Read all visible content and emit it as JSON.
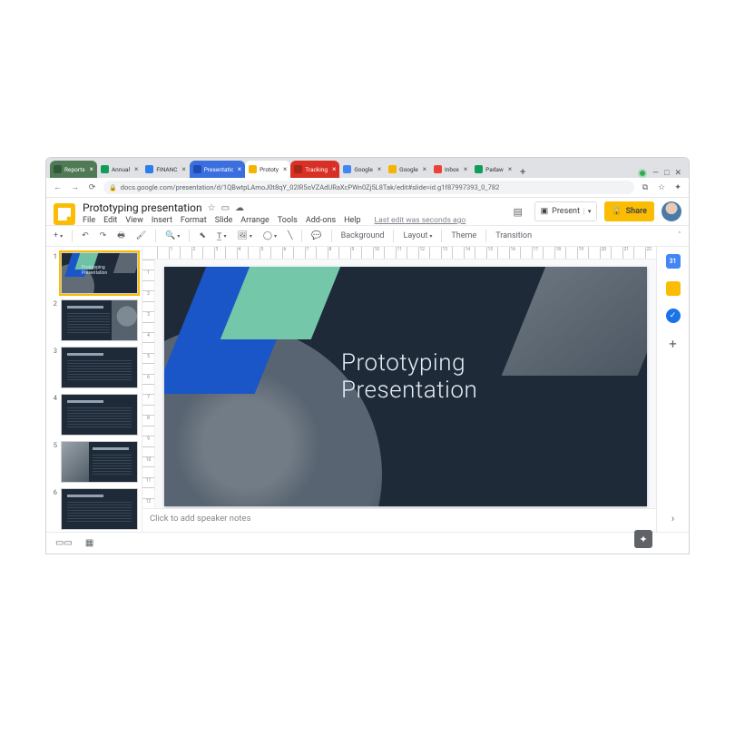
{
  "browser": {
    "tabs": [
      {
        "label": "Reports",
        "color": "#4f7a55",
        "text": "#fff",
        "fav": "#2f5a38"
      },
      {
        "label": "Annual",
        "color": "",
        "text": "",
        "fav": "#0f9d58"
      },
      {
        "label": "FINANC",
        "color": "",
        "text": "",
        "fav": "#2b7de9"
      },
      {
        "label": "Presentations",
        "color": "#3b6fe0",
        "text": "#fff",
        "fav": "#1c4db3"
      },
      {
        "label": "Prototy",
        "color": "#fff",
        "text": "#333",
        "fav": "#f4b400",
        "active": true
      },
      {
        "label": "Tracking",
        "color": "#d93025",
        "text": "#fff",
        "fav": "#a52714"
      },
      {
        "label": "Google",
        "color": "",
        "text": "",
        "fav": "#4285f4"
      },
      {
        "label": "Google",
        "color": "",
        "text": "",
        "fav": "#f4b400"
      },
      {
        "label": "Inbox",
        "color": "",
        "text": "",
        "fav": "#ea4335"
      },
      {
        "label": "Padaw",
        "color": "",
        "text": "",
        "fav": "#0f9d58"
      }
    ],
    "url": "docs.google.com/presentation/d/1QBwtpLAmoJ0t8qY_02IR5oVZAdURaXcPWn0Zj5L8Tak/edit#slide=id.g1f87997393_0_782"
  },
  "app": {
    "title": "Prototyping presentation",
    "menus": [
      "File",
      "Edit",
      "View",
      "Insert",
      "Format",
      "Slide",
      "Arrange",
      "Tools",
      "Add-ons",
      "Help"
    ],
    "status": "Last edit was seconds ago",
    "present": "Present",
    "share": "Share"
  },
  "toolbar": {
    "background": "Background",
    "layout": "Layout",
    "theme": "Theme",
    "transition": "Transition"
  },
  "slide": {
    "line1": "Prototyping",
    "line2": "Presentation"
  },
  "thumbs": [
    {
      "n": "1",
      "kind": "title",
      "t1": "Prototyping",
      "t2": "Presentation"
    },
    {
      "n": "2",
      "kind": "content-right"
    },
    {
      "n": "3",
      "kind": "content-plain"
    },
    {
      "n": "4",
      "kind": "content-plain"
    },
    {
      "n": "5",
      "kind": "content-left"
    },
    {
      "n": "6",
      "kind": "content-plain"
    }
  ],
  "notes_placeholder": "Click to add speaker notes",
  "ruler_h": [
    "",
    "1",
    "",
    "2",
    "",
    "3",
    "",
    "4",
    "",
    "5",
    "",
    "6",
    "",
    "7",
    "",
    "8",
    "",
    "9",
    "",
    "10",
    "",
    "11",
    "",
    "12",
    "",
    "13",
    "",
    "14",
    "",
    "15",
    "",
    "16",
    "",
    "17",
    "",
    "18",
    "",
    "19",
    "",
    "20",
    "",
    "21",
    "",
    "22"
  ],
  "ruler_v": [
    "",
    "1",
    "",
    "2",
    "",
    "3",
    "",
    "4",
    "",
    "5",
    "",
    "6",
    "",
    "7",
    "",
    "8",
    "",
    "9",
    "",
    "10",
    "",
    "11",
    "",
    "12"
  ]
}
